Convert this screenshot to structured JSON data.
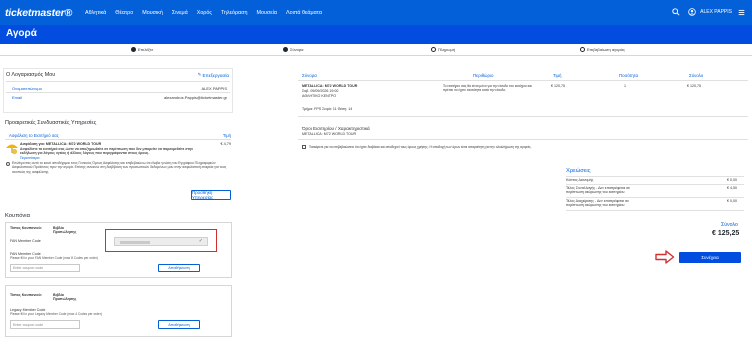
{
  "header": {
    "logo": "ticketmaster®",
    "nav": [
      "Αθλητικά",
      "Θέατρο",
      "Μουσική",
      "Σινεμά",
      "Χορός",
      "Τηλεόραση",
      "Μουσεία",
      "Λοιπά θεάματα"
    ],
    "user_name": "ALEX PAPPIS"
  },
  "page_title": "Αγορά",
  "stepper": [
    "Επιλέξτε",
    "Σύνορα",
    "Πληρωμή",
    "Επιβεβαίωση αγοράς"
  ],
  "account": {
    "title": "Ο Λογαριασμός Μου",
    "edit": "Επεξεργασία",
    "fields": [
      {
        "label": "Ονοματεπώνυμο",
        "value": "ALEX PAPPIS"
      },
      {
        "label": "Email",
        "value": "alexandros.Pappis@ticketmaster.gr"
      }
    ]
  },
  "services": {
    "title": "Προαιρετικές Συνδυαστικές Υπηρεσίες",
    "col_left": "Ασφάλιση το Εισιτήριό σας",
    "col_right": "Τιμή",
    "product_title": "Ασφάλιση για: METALLICA: M72 WORLD TOUR",
    "product_desc": "Ασφαλίστε τα εισιτήριά σας ώστε να αποζημιωθείτε σε περίπτωση που δεν μπορείτε να παρευρεθείτε στην εκδήλωση για λόγους υγείας ή άλλους λόγους που περιγράφονται στους όρους.",
    "product_link": "Περισσότερα",
    "price": "€ 4,79",
    "consent": "Επιλέγοντας αυτό το κουτί αποδέχομαι τους Γενικούς Όρους Ασφάλισης και επιβεβαιώνω ότι έλαβα γνώση του Εγγράφου Πληροφοριών Ασφαλιστικού Προϊόντος πριν την αγορά. Επίσης συναινώ στη διαβίβαση των προσωπικών δεδομένων μου στην ασφαλιστική εταιρεία για τους σκοπούς της ασφάλισης.",
    "consent_link": "Έγγραφο Πληροφοριών Ασφαλιστικού Προϊόντος",
    "button": "Προσθήκη Υπηρεσίας"
  },
  "coupons": {
    "title": "Κουπόνια",
    "box1": {
      "type_label": "Τύπος Κουπονιού:",
      "type_value": "Βιβλίο Προπώλησης",
      "code_label": "FAN Member Code",
      "code_label2": "FAN Member Code",
      "help": "Please fill in your FAN Member Code (max 8 Codes per order)",
      "placeholder": "Enter coupon code",
      "apply": "Αποθήκευση"
    },
    "box2": {
      "type_label": "Τύπος Κουπονιού:",
      "type_value": "Βιβλίο Προπώλησης",
      "code_label": "Legacy Member Code",
      "help": "Please fill in your Legacy Member Code (max 4 Codes per order)",
      "placeholder": "Enter coupon code",
      "apply": "Αποθήκευση"
    }
  },
  "order": {
    "headers": [
      "Σύνορα",
      "Περιθώριο",
      "Τιμή",
      "Ποσότητα",
      "Σύνολο"
    ],
    "event_name": "METALLICA: M72 WORLD TOUR",
    "event_date": "Σαβ. 09/09/2026 19:00",
    "event_venue": "ΑΘΛΗΤΙΚΟ ΚΕΝΤΡΟ",
    "description": "Το εισιτήριο σας θα είναι μόνο για την είσοδο του κατόχου και πρέπει να έχετε ταυτότητα κατά την είσοδο.",
    "price": "€ 120,75",
    "qty": "1",
    "total": "€ 120,75",
    "seat_info": "Τμήμα: FPS  Σειρά: 11  Θέση: 14",
    "conditions_title": "Όροι Εισιτηρίου / Χαρακτηριστικά",
    "conditions_event": "METALLICA: M72 WORLD TOUR",
    "conditions_check": "Τσεκάρετε για να επιβεβαιώσετε ότι έχετε διαβάσει και αποδεχτεί τους όρους χρήσης. Η αποδοχή των όρων είναι απαραίτητη για την ολοκλήρωση της αγοράς."
  },
  "charges": {
    "title": "Χρεώσεις",
    "rows": [
      {
        "label": "Κόστος Διανομής",
        "value": "€ 0,00"
      },
      {
        "label": "Τέλος Συναλλαγής - Δεν επιστρέφεται σε περίπτωση ακύρωσης του εισιτηρίου",
        "value": "€ 4,50"
      },
      {
        "label": "Τέλος Διαχείρισης - Δεν επιστρέφεται σε περίπτωση ακύρωσης του εισιτηρίου",
        "value": "€ 0,00"
      }
    ],
    "total_label": "Σύνολο",
    "total_value": "€ 125,25"
  },
  "continue_button": "Συνέχεια",
  "colors": {
    "brand": "#024ddf",
    "nav": "#0460d9",
    "highlight": "#d32f2f"
  }
}
